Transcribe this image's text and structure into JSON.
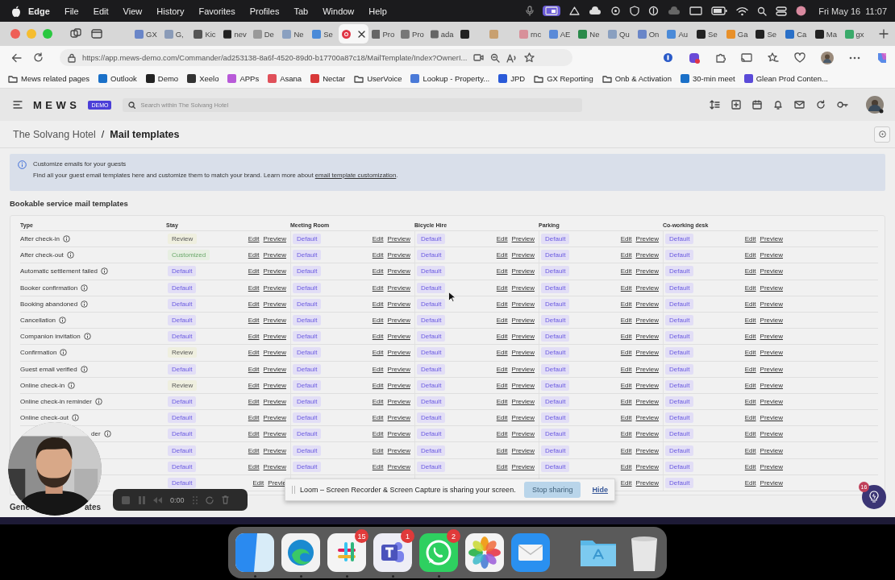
{
  "menu_bar": {
    "app": "Edge",
    "items": [
      "File",
      "Edit",
      "View",
      "History",
      "Favorites",
      "Profiles",
      "Tab",
      "Window",
      "Help"
    ],
    "clock": "Fri May 16  11:07"
  },
  "tabs": [
    {
      "title": "GX",
      "selected": false
    },
    {
      "title": "G,",
      "selected": false
    },
    {
      "title": "Kic",
      "selected": false
    },
    {
      "title": "nev",
      "selected": false
    },
    {
      "title": "De",
      "selected": false
    },
    {
      "title": "Ne",
      "selected": false
    },
    {
      "title": "Se",
      "selected": false
    },
    {
      "selected": true
    },
    {
      "title": "Pro",
      "selected": false
    },
    {
      "title": "Pro",
      "selected": false
    },
    {
      "title": "ada",
      "selected": false
    },
    {
      "selected": false
    },
    {
      "selected": false
    },
    {
      "title": "rnc",
      "selected": false
    },
    {
      "title": "AE",
      "selected": false
    },
    {
      "title": "Ne",
      "selected": false
    },
    {
      "title": "Qu",
      "selected": false
    },
    {
      "title": "On",
      "selected": false
    },
    {
      "title": "Au",
      "selected": false
    },
    {
      "title": "Se",
      "selected": false
    },
    {
      "title": "Ga",
      "selected": false
    },
    {
      "title": "Se",
      "selected": false
    },
    {
      "title": "Ca",
      "selected": false
    },
    {
      "title": "Ma",
      "selected": false
    },
    {
      "title": "gx",
      "selected": false
    }
  ],
  "address_bar": {
    "url": "https://app.mews-demo.com/Commander/ad253138-8a6f-4520-89d0-b17700a87c18/MailTemplate/Index?OwnerI..."
  },
  "bookmarks": [
    "Mews related pages",
    "Outlook",
    "Demo",
    "Xeelo",
    "APPs",
    "Asana",
    "Nectar",
    "UserVoice",
    "Lookup - Property...",
    "JPD",
    "GX Reporting",
    "Onb & Activation",
    "30-min meet",
    "Glean Prod Conten..."
  ],
  "app_header": {
    "logo": "MEWS",
    "badge": "DEMO",
    "search": {
      "placeholder": "Search within The Solvang Hotel"
    }
  },
  "breadcrumb": {
    "items": [
      "The Solvang Hotel",
      "Mail templates"
    ],
    "separator": "/"
  },
  "banner": {
    "title": "Customize emails for your guests",
    "text": "Find all your guest email templates here and customize them to match your brand. Learn more about ",
    "link": "email template customization",
    "after": "."
  },
  "section_title": "Bookable service mail templates",
  "table": {
    "type_column": "Type",
    "service_columns": [
      "Stay",
      "Meeting Room",
      "Bicycle Hire",
      "Parking",
      "Co-working desk"
    ],
    "rows": [
      {
        "type": "After check-in",
        "kind": "plain",
        "cells": [
          {
            "status": "Review",
            "kind": "review",
            "actions": [
              "Edit",
              "Preview"
            ]
          },
          {
            "status": "Default",
            "kind": "default",
            "actions": [
              "Edit",
              "Preview"
            ]
          },
          {
            "status": "Default",
            "kind": "default",
            "actions": [
              "Edit",
              "Preview"
            ]
          },
          {
            "status": "Default",
            "kind": "default",
            "actions": [
              "Edit",
              "Preview"
            ]
          },
          {
            "status": "Default",
            "kind": "default",
            "actions": [
              "Edit",
              "Preview"
            ]
          }
        ]
      },
      {
        "type": "After check-out",
        "kind": "plain",
        "cells": [
          {
            "status": "Customized",
            "kind": "customized",
            "actions": [
              "Edit",
              "Preview"
            ]
          },
          {
            "status": "Default",
            "kind": "default",
            "actions": [
              "Edit",
              "Preview"
            ]
          },
          {
            "status": "Default",
            "kind": "default",
            "actions": [
              "Edit",
              "Preview"
            ]
          },
          {
            "status": "Default",
            "kind": "default",
            "actions": [
              "Edit",
              "Preview"
            ]
          },
          {
            "status": "Default",
            "kind": "default",
            "actions": [
              "Edit",
              "Preview"
            ]
          }
        ]
      },
      {
        "type": "Automatic settlement failed",
        "kind": "plain",
        "cells": [
          {
            "status": "Default",
            "kind": "default",
            "actions": [
              "Edit",
              "Preview"
            ]
          },
          {
            "status": "Default",
            "kind": "default",
            "actions": [
              "Edit",
              "Preview"
            ]
          },
          {
            "status": "Default",
            "kind": "default",
            "actions": [
              "Edit",
              "Preview"
            ]
          },
          {
            "status": "Default",
            "kind": "default",
            "actions": [
              "Edit",
              "Preview"
            ]
          },
          {
            "status": "Default",
            "kind": "default",
            "actions": [
              "Edit",
              "Preview"
            ]
          }
        ]
      },
      {
        "type": "Booker confirmation",
        "kind": "plain",
        "cells": [
          {
            "status": "Default",
            "kind": "default",
            "actions": [
              "Edit",
              "Preview"
            ]
          },
          {
            "status": "Default",
            "kind": "default",
            "actions": [
              "Edit",
              "Preview"
            ]
          },
          {
            "status": "Default",
            "kind": "default",
            "actions": [
              "Edit",
              "Preview"
            ]
          },
          {
            "status": "Default",
            "kind": "default",
            "actions": [
              "Edit",
              "Preview"
            ]
          },
          {
            "status": "Default",
            "kind": "default",
            "actions": [
              "Edit",
              "Preview"
            ]
          }
        ]
      },
      {
        "type": "Booking abandoned",
        "kind": "plain",
        "cells": [
          {
            "status": "Default",
            "kind": "default",
            "actions": [
              "Edit",
              "Preview"
            ]
          },
          {
            "status": "Default",
            "kind": "default",
            "actions": [
              "Edit",
              "Preview"
            ]
          },
          {
            "status": "Default",
            "kind": "default",
            "actions": [
              "Edit",
              "Preview"
            ]
          },
          {
            "status": "Default",
            "kind": "default",
            "actions": [
              "Edit",
              "Preview"
            ]
          },
          {
            "status": "Default",
            "kind": "default",
            "actions": [
              "Edit",
              "Preview"
            ]
          }
        ]
      },
      {
        "type": "Cancellation",
        "kind": "plain",
        "cells": [
          {
            "status": "Default",
            "kind": "default",
            "actions": [
              "Edit",
              "Preview"
            ]
          },
          {
            "status": "Default",
            "kind": "default",
            "actions": [
              "Edit",
              "Preview"
            ]
          },
          {
            "status": "Default",
            "kind": "default",
            "actions": [
              "Edit",
              "Preview"
            ]
          },
          {
            "status": "Default",
            "kind": "default",
            "actions": [
              "Edit",
              "Preview"
            ]
          },
          {
            "status": "Default",
            "kind": "default",
            "actions": [
              "Edit",
              "Preview"
            ]
          }
        ]
      },
      {
        "type": "Companion invitation",
        "kind": "plain",
        "cells": [
          {
            "status": "Default",
            "kind": "default",
            "actions": [
              "Edit",
              "Preview"
            ]
          },
          {
            "status": "Default",
            "kind": "default",
            "actions": [
              "Edit",
              "Preview"
            ]
          },
          {
            "status": "Default",
            "kind": "default",
            "actions": [
              "Edit",
              "Preview"
            ]
          },
          {
            "status": "Default",
            "kind": "default",
            "actions": [
              "Edit",
              "Preview"
            ]
          },
          {
            "status": "Default",
            "kind": "default",
            "actions": [
              "Edit",
              "Preview"
            ]
          }
        ]
      },
      {
        "type": "Confirmation",
        "kind": "plain",
        "cells": [
          {
            "status": "Review",
            "kind": "review",
            "actions": [
              "Edit",
              "Preview"
            ]
          },
          {
            "status": "Default",
            "kind": "default",
            "actions": [
              "Edit",
              "Preview"
            ]
          },
          {
            "status": "Default",
            "kind": "default",
            "actions": [
              "Edit",
              "Preview"
            ]
          },
          {
            "status": "Default",
            "kind": "default",
            "actions": [
              "Edit",
              "Preview"
            ]
          },
          {
            "status": "Default",
            "kind": "default",
            "actions": [
              "Edit",
              "Preview"
            ]
          }
        ]
      },
      {
        "type": "Guest email verified",
        "kind": "plain",
        "cells": [
          {
            "status": "Default",
            "kind": "default",
            "actions": [
              "Edit",
              "Preview"
            ]
          },
          {
            "status": "Default",
            "kind": "default",
            "actions": [
              "Edit",
              "Preview"
            ]
          },
          {
            "status": "Default",
            "kind": "default",
            "actions": [
              "Edit",
              "Preview"
            ]
          },
          {
            "status": "Default",
            "kind": "default",
            "actions": [
              "Edit",
              "Preview"
            ]
          },
          {
            "status": "Default",
            "kind": "default",
            "actions": [
              "Edit",
              "Preview"
            ]
          }
        ]
      },
      {
        "type": "Online check-in",
        "kind": "plain",
        "cells": [
          {
            "status": "Review",
            "kind": "review",
            "actions": [
              "Edit",
              "Preview"
            ]
          },
          {
            "status": "Default",
            "kind": "default",
            "actions": [
              "Edit",
              "Preview"
            ]
          },
          {
            "status": "Default",
            "kind": "default",
            "actions": [
              "Edit",
              "Preview"
            ]
          },
          {
            "status": "Default",
            "kind": "default",
            "actions": [
              "Edit",
              "Preview"
            ]
          },
          {
            "status": "Default",
            "kind": "default",
            "actions": [
              "Edit",
              "Preview"
            ]
          }
        ]
      },
      {
        "type": "Online check-in reminder",
        "kind": "plain",
        "cells": [
          {
            "status": "Default",
            "kind": "default",
            "actions": [
              "Edit",
              "Preview"
            ]
          },
          {
            "status": "Default",
            "kind": "default",
            "actions": [
              "Edit",
              "Preview"
            ]
          },
          {
            "status": "Default",
            "kind": "default",
            "actions": [
              "Edit",
              "Preview"
            ]
          },
          {
            "status": "Default",
            "kind": "default",
            "actions": [
              "Edit",
              "Preview"
            ]
          },
          {
            "status": "Default",
            "kind": "default",
            "actions": [
              "Edit",
              "Preview"
            ]
          }
        ]
      },
      {
        "type": "Online check-out",
        "kind": "plain",
        "cells": [
          {
            "status": "Default",
            "kind": "default",
            "actions": [
              "Edit",
              "Preview"
            ]
          },
          {
            "status": "Default",
            "kind": "default",
            "actions": [
              "Edit",
              "Preview"
            ]
          },
          {
            "status": "Default",
            "kind": "default",
            "actions": [
              "Edit",
              "Preview"
            ]
          },
          {
            "status": "Default",
            "kind": "default",
            "actions": [
              "Edit",
              "Preview"
            ]
          },
          {
            "status": "Default",
            "kind": "default",
            "actions": [
              "Edit",
              "Preview"
            ]
          }
        ]
      },
      {
        "type": "der",
        "kind": "partial",
        "cells": [
          {
            "status": "Default",
            "kind": "default",
            "actions": [
              "Edit",
              "Preview"
            ]
          },
          {
            "status": "Default",
            "kind": "default",
            "actions": [
              "Edit",
              "Preview"
            ]
          },
          {
            "status": "Default",
            "kind": "default",
            "actions": [
              "Edit",
              "Preview"
            ]
          },
          {
            "status": "Default",
            "kind": "default",
            "actions": [
              "Edit",
              "Preview"
            ]
          },
          {
            "status": "Default",
            "kind": "default",
            "actions": [
              "Edit",
              "Preview"
            ]
          }
        ]
      },
      {
        "kind": "plain",
        "cells": [
          {
            "status": "Default",
            "kind": "default",
            "actions": [
              "Edit",
              "Preview"
            ]
          },
          {
            "status": "Default",
            "kind": "default",
            "actions": [
              "Edit",
              "Preview"
            ]
          },
          {
            "status": "Default",
            "kind": "default",
            "actions": [
              "Edit",
              "Preview"
            ]
          },
          {
            "status": "Default",
            "kind": "default",
            "actions": [
              "Edit",
              "Preview"
            ]
          },
          {
            "status": "Default",
            "kind": "default",
            "actions": [
              "Edit",
              "Preview"
            ]
          }
        ]
      },
      {
        "kind": "plain",
        "cells": [
          {
            "status": "Default",
            "kind": "default",
            "actions": [
              "Edit",
              "Preview"
            ]
          },
          {
            "status": "Default",
            "kind": "default",
            "actions": [
              "Edit",
              "Preview"
            ]
          },
          {
            "status": "Default",
            "kind": "default",
            "actions": [
              "Edit",
              "Preview"
            ]
          },
          {
            "status": "Default",
            "kind": "default",
            "actions": [
              "Edit",
              "Preview"
            ]
          },
          {
            "status": "Default",
            "kind": "default",
            "actions": [
              "Edit",
              "Preview"
            ]
          }
        ]
      },
      {
        "kind": "plain",
        "cells": [
          {
            "status": "Default",
            "kind": "default",
            "actions": [
              "Edit",
              "Previe"
            ]
          },
          {},
          {},
          {
            "actions": [
              "Edit",
              "Preview"
            ]
          },
          {
            "status": "Default",
            "kind": "default",
            "actions": [
              "Edit",
              "Preview"
            ]
          }
        ]
      }
    ]
  },
  "next_section_title_parts": [
    "Gene",
    "ates"
  ],
  "loom": {
    "recorder": {
      "time": "0:00"
    },
    "notice": {
      "text": "Loom – Screen Recorder & Screen Capture is sharing your screen.",
      "stop": "Stop sharing",
      "hide": "Hide"
    }
  },
  "help_button": {
    "badge": "16"
  },
  "dock": {
    "apps": [
      {
        "kind": "finder",
        "running": true
      },
      {
        "kind": "browser",
        "running": true
      },
      {
        "kind": "chat",
        "running": true,
        "badge": "15"
      },
      {
        "kind": "team",
        "running": true,
        "badge": "1"
      },
      {
        "kind": "phone",
        "running": true,
        "badge": "2"
      },
      {
        "kind": "photos",
        "running": false
      },
      {
        "kind": "mail",
        "running": false
      },
      {
        "kind": "separator"
      },
      {
        "kind": "folder",
        "running": false
      },
      {
        "kind": "trash",
        "running": false
      }
    ]
  }
}
